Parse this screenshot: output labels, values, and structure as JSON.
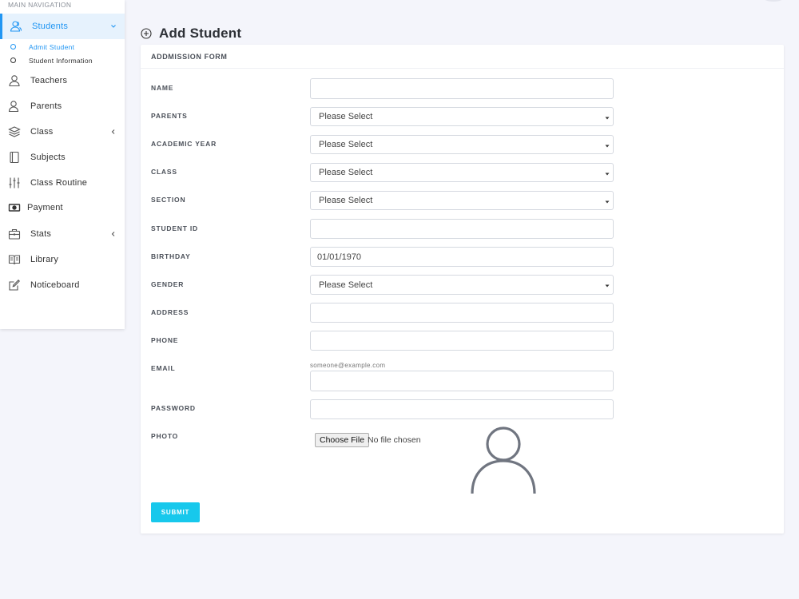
{
  "sidebar": {
    "header": "MAIN NAVIGATION",
    "items": [
      {
        "label": "Students"
      },
      {
        "label": "Teachers"
      },
      {
        "label": "Parents"
      },
      {
        "label": "Class"
      },
      {
        "label": "Subjects"
      },
      {
        "label": "Class Routine"
      },
      {
        "label": "Payment"
      },
      {
        "label": "Stats"
      },
      {
        "label": "Library"
      },
      {
        "label": "Noticeboard"
      }
    ],
    "subitems": [
      {
        "label": "Admit Student"
      },
      {
        "label": "Student Information"
      }
    ]
  },
  "page": {
    "title": "Add Student"
  },
  "form": {
    "header": "ADDMISSION FORM",
    "labels": {
      "name": "NAME",
      "parents": "PARENTS",
      "academic_year": "ACADEMIC YEAR",
      "class": "CLASS",
      "section": "SECTION",
      "student_id": "STUDENT ID",
      "birthday": "BIRTHDAY",
      "gender": "GENDER",
      "address": "ADDRESS",
      "phone": "PHONE",
      "email": "EMAIL",
      "password": "PASSWORD",
      "photo": "PHOTO"
    },
    "values": {
      "parents": "Please Select",
      "academic_year": "Please Select",
      "class": "Please Select",
      "section": "Please Select",
      "birthday": "01/01/1970",
      "gender": "Please Select"
    },
    "email_hint": "someone@example.com",
    "file_button": "Choose File",
    "file_status": "No file chosen",
    "submit": "SUBMIT"
  },
  "colors": {
    "accent": "#2196f3",
    "submit": "#17c8ec",
    "background": "#f4f5fb"
  },
  "icons": {
    "students": "user-group-icon",
    "teachers": "user-icon",
    "parents": "user-icon",
    "class": "layers-icon",
    "subjects": "book-icon",
    "class_routine": "sliders-icon",
    "payment": "money-icon",
    "stats": "briefcase-icon",
    "library": "open-book-icon",
    "noticeboard": "edit-icon"
  }
}
